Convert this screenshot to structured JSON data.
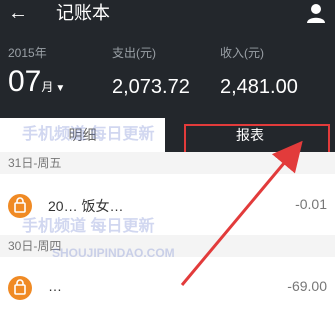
{
  "header": {
    "title": "记账本",
    "year": "2015年",
    "month": "07",
    "month_unit": "月",
    "expense_label": "支出(元)",
    "expense_value": "2,073.72",
    "income_label": "收入(元)",
    "income_value": "2,481.00"
  },
  "tabs": {
    "detail": "明细",
    "report": "报表"
  },
  "groups": [
    {
      "date": "31日-周五",
      "item_text": "20… 饭女…",
      "amount": "-0.01"
    },
    {
      "date": "30日-周四",
      "item_text": "…",
      "amount": "-69.00"
    }
  ],
  "watermark": {
    "line1": "手机频道 每日更新",
    "line2": "SHOUJIPINDAO.COM"
  },
  "colors": {
    "header_bg": "#23272c",
    "accent": "#f08a24",
    "highlight": "#e23b3b"
  }
}
